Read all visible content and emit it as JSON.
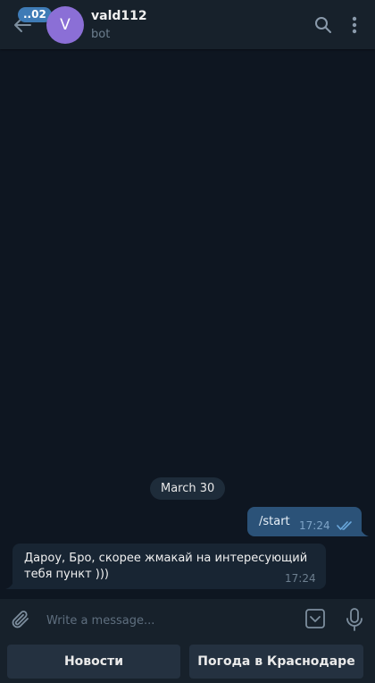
{
  "header": {
    "unread_count": "..02",
    "avatar_letter": "V",
    "chat_name": "vald112",
    "chat_status": "bot"
  },
  "messages": {
    "date_separator": "March 30",
    "outgoing": {
      "text": "/start",
      "time": "17:24",
      "status": "read"
    },
    "incoming": {
      "text": "Дароу, Бро, скорее жмакай на интересующий тебя пункт )))",
      "time": "17:24"
    }
  },
  "composer": {
    "placeholder": "Write a message..."
  },
  "bot_keyboard": {
    "buttons": [
      "Новости",
      "Погода в Краснодаре"
    ]
  },
  "colors": {
    "background": "#0e1621",
    "header": "#17212b",
    "accent": "#3e7bb6",
    "outgoing_bubble": "#2b5278",
    "incoming_bubble": "#182533",
    "avatar": "#8b6fd6"
  }
}
